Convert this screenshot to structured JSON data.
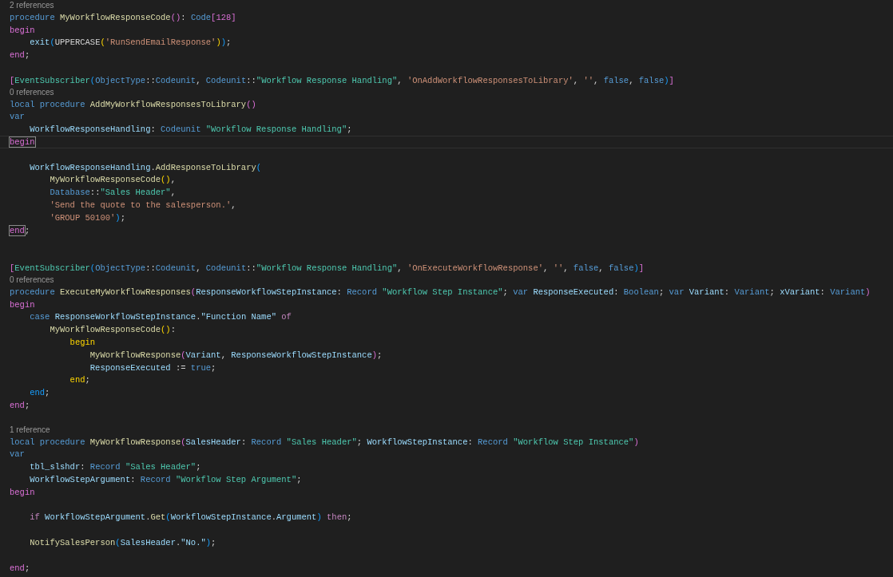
{
  "editor": {
    "lines": [
      {
        "kind": "lens",
        "text": "2 references"
      },
      {
        "kind": "code",
        "tokens": [
          {
            "kind": "kw",
            "text": "procedure"
          },
          {
            "kind": "fn",
            "text": " MyWorkflowResponseCode"
          },
          {
            "kind": "b2",
            "text": "()"
          },
          {
            "kind": "p",
            "text": ": "
          },
          {
            "kind": "kw",
            "text": "Code"
          },
          {
            "kind": "b2",
            "text": "[128]"
          }
        ]
      },
      {
        "kind": "code",
        "tokens": [
          {
            "kind": "b2",
            "text": "begin"
          }
        ]
      },
      {
        "kind": "code",
        "tokens": [
          {
            "kind": "var",
            "text": "    exit"
          },
          {
            "kind": "b3",
            "text": "("
          },
          {
            "kind": "p",
            "text": "UPPERCASE"
          },
          {
            "kind": "b1",
            "text": "("
          },
          {
            "kind": "str",
            "text": "'RunSendEmailResponse'"
          },
          {
            "kind": "b1",
            "text": ")"
          },
          {
            "kind": "b3",
            "text": ")"
          },
          {
            "kind": "p",
            "text": ";"
          }
        ]
      },
      {
        "kind": "code",
        "tokens": [
          {
            "kind": "b2",
            "text": "end"
          },
          {
            "kind": "p",
            "text": ";"
          }
        ]
      },
      {
        "kind": "blank"
      },
      {
        "kind": "code",
        "tokens": [
          {
            "kind": "b2",
            "text": "["
          },
          {
            "kind": "qid",
            "text": "EventSubscriber"
          },
          {
            "kind": "b3",
            "text": "("
          },
          {
            "kind": "kw",
            "text": "ObjectType"
          },
          {
            "kind": "p",
            "text": "::"
          },
          {
            "kind": "kw",
            "text": "Codeunit"
          },
          {
            "kind": "p",
            "text": ", "
          },
          {
            "kind": "kw",
            "text": "Codeunit"
          },
          {
            "kind": "p",
            "text": "::"
          },
          {
            "kind": "qid",
            "text": "\"Workflow Response Handling\""
          },
          {
            "kind": "p",
            "text": ", "
          },
          {
            "kind": "str",
            "text": "'OnAddWorkflowResponsesToLibrary'"
          },
          {
            "kind": "p",
            "text": ", "
          },
          {
            "kind": "str",
            "text": "''"
          },
          {
            "kind": "p",
            "text": ", "
          },
          {
            "kind": "kw",
            "text": "false"
          },
          {
            "kind": "p",
            "text": ", "
          },
          {
            "kind": "kw",
            "text": "false"
          },
          {
            "kind": "b3",
            "text": ")"
          },
          {
            "kind": "b2",
            "text": "]"
          }
        ]
      },
      {
        "kind": "lens",
        "text": "0 references"
      },
      {
        "kind": "code",
        "tokens": [
          {
            "kind": "kw",
            "text": "local procedure"
          },
          {
            "kind": "fn",
            "text": " AddMyWorkflowResponsesToLibrary"
          },
          {
            "kind": "b2",
            "text": "()"
          }
        ]
      },
      {
        "kind": "code",
        "tokens": [
          {
            "kind": "kw",
            "text": "var"
          }
        ]
      },
      {
        "kind": "code",
        "tokens": [
          {
            "kind": "var",
            "text": "    WorkflowResponseHandling"
          },
          {
            "kind": "p",
            "text": ": "
          },
          {
            "kind": "kw",
            "text": "Codeunit"
          },
          {
            "kind": "qid",
            "text": " \"Workflow Response Handling\""
          },
          {
            "kind": "p",
            "text": ";"
          }
        ]
      },
      {
        "kind": "current",
        "tokens": [
          {
            "kind": "match",
            "text": "begin"
          }
        ]
      },
      {
        "kind": "blank"
      },
      {
        "kind": "code",
        "tokens": [
          {
            "kind": "var",
            "text": "    WorkflowResponseHandling"
          },
          {
            "kind": "p",
            "text": "."
          },
          {
            "kind": "fn",
            "text": "AddResponseToLibrary"
          },
          {
            "kind": "b3",
            "text": "("
          }
        ]
      },
      {
        "kind": "code",
        "tokens": [
          {
            "kind": "fn",
            "text": "        MyWorkflowResponseCode"
          },
          {
            "kind": "b1",
            "text": "()"
          },
          {
            "kind": "p",
            "text": ","
          }
        ]
      },
      {
        "kind": "code",
        "tokens": [
          {
            "kind": "kw",
            "text": "        Database"
          },
          {
            "kind": "p",
            "text": "::"
          },
          {
            "kind": "qid",
            "text": "\"Sales Header\""
          },
          {
            "kind": "p",
            "text": ","
          }
        ]
      },
      {
        "kind": "code",
        "tokens": [
          {
            "kind": "str",
            "text": "        'Send the quote to the salesperson.'"
          },
          {
            "kind": "p",
            "text": ","
          }
        ]
      },
      {
        "kind": "code",
        "tokens": [
          {
            "kind": "str",
            "text": "        'GROUP 50100'"
          },
          {
            "kind": "b3",
            "text": ")"
          },
          {
            "kind": "p",
            "text": ";"
          }
        ]
      },
      {
        "kind": "code",
        "tokens": [
          {
            "kind": "match",
            "text": "end"
          },
          {
            "kind": "p",
            "text": ";"
          }
        ]
      },
      {
        "kind": "blank"
      },
      {
        "kind": "blank"
      },
      {
        "kind": "code",
        "tokens": [
          {
            "kind": "b2",
            "text": "["
          },
          {
            "kind": "qid",
            "text": "EventSubscriber"
          },
          {
            "kind": "b3",
            "text": "("
          },
          {
            "kind": "kw",
            "text": "ObjectType"
          },
          {
            "kind": "p",
            "text": "::"
          },
          {
            "kind": "kw",
            "text": "Codeunit"
          },
          {
            "kind": "p",
            "text": ", "
          },
          {
            "kind": "kw",
            "text": "Codeunit"
          },
          {
            "kind": "p",
            "text": "::"
          },
          {
            "kind": "qid",
            "text": "\"Workflow Response Handling\""
          },
          {
            "kind": "p",
            "text": ", "
          },
          {
            "kind": "str",
            "text": "'OnExecuteWorkflowResponse'"
          },
          {
            "kind": "p",
            "text": ", "
          },
          {
            "kind": "str",
            "text": "''"
          },
          {
            "kind": "p",
            "text": ", "
          },
          {
            "kind": "kw",
            "text": "false"
          },
          {
            "kind": "p",
            "text": ", "
          },
          {
            "kind": "kw",
            "text": "false"
          },
          {
            "kind": "b3",
            "text": ")"
          },
          {
            "kind": "b2",
            "text": "]"
          }
        ]
      },
      {
        "kind": "lens",
        "text": "0 references"
      },
      {
        "kind": "code",
        "tokens": [
          {
            "kind": "kw",
            "text": "procedure"
          },
          {
            "kind": "fn",
            "text": " ExecuteMyWorkflowResponses"
          },
          {
            "kind": "b2",
            "text": "("
          },
          {
            "kind": "var",
            "text": "ResponseWorkflowStepInstance"
          },
          {
            "kind": "p",
            "text": ": "
          },
          {
            "kind": "kw",
            "text": "Record"
          },
          {
            "kind": "qid",
            "text": " \"Workflow Step Instance\""
          },
          {
            "kind": "p",
            "text": "; "
          },
          {
            "kind": "kw",
            "text": "var"
          },
          {
            "kind": "var",
            "text": " ResponseExecuted"
          },
          {
            "kind": "p",
            "text": ": "
          },
          {
            "kind": "kw",
            "text": "Boolean"
          },
          {
            "kind": "p",
            "text": "; "
          },
          {
            "kind": "kw",
            "text": "var"
          },
          {
            "kind": "var",
            "text": " Variant"
          },
          {
            "kind": "p",
            "text": ": "
          },
          {
            "kind": "kw",
            "text": "Variant"
          },
          {
            "kind": "p",
            "text": "; "
          },
          {
            "kind": "var",
            "text": "xVariant"
          },
          {
            "kind": "p",
            "text": ": "
          },
          {
            "kind": "kw",
            "text": "Variant"
          },
          {
            "kind": "b2",
            "text": ")"
          }
        ]
      },
      {
        "kind": "code",
        "tokens": [
          {
            "kind": "b2",
            "text": "begin"
          }
        ]
      },
      {
        "kind": "code",
        "tokens": [
          {
            "kind": "kw",
            "text": "    case"
          },
          {
            "kind": "var",
            "text": " ResponseWorkflowStepInstance"
          },
          {
            "kind": "p",
            "text": "."
          },
          {
            "kind": "var",
            "text": "\"Function Name\""
          },
          {
            "kind": "ctl",
            "text": " of"
          }
        ]
      },
      {
        "kind": "code",
        "tokens": [
          {
            "kind": "fn",
            "text": "        MyWorkflowResponseCode"
          },
          {
            "kind": "b1",
            "text": "()"
          },
          {
            "kind": "p",
            "text": ":"
          }
        ]
      },
      {
        "kind": "code",
        "tokens": [
          {
            "kind": "b1",
            "text": "            begin"
          }
        ]
      },
      {
        "kind": "code",
        "tokens": [
          {
            "kind": "fn",
            "text": "                MyWorkflowResponse"
          },
          {
            "kind": "b2",
            "text": "("
          },
          {
            "kind": "var",
            "text": "Variant"
          },
          {
            "kind": "p",
            "text": ", "
          },
          {
            "kind": "var",
            "text": "ResponseWorkflowStepInstance"
          },
          {
            "kind": "b2",
            "text": ")"
          },
          {
            "kind": "p",
            "text": ";"
          }
        ]
      },
      {
        "kind": "code",
        "tokens": [
          {
            "kind": "var",
            "text": "                ResponseExecuted"
          },
          {
            "kind": "p",
            "text": " := "
          },
          {
            "kind": "kw",
            "text": "true"
          },
          {
            "kind": "p",
            "text": ";"
          }
        ]
      },
      {
        "kind": "code",
        "tokens": [
          {
            "kind": "b1",
            "text": "            end"
          },
          {
            "kind": "p",
            "text": ";"
          }
        ]
      },
      {
        "kind": "code",
        "tokens": [
          {
            "kind": "b3",
            "text": "    end"
          },
          {
            "kind": "p",
            "text": ";"
          }
        ]
      },
      {
        "kind": "code",
        "tokens": [
          {
            "kind": "b2",
            "text": "end"
          },
          {
            "kind": "p",
            "text": ";"
          }
        ]
      },
      {
        "kind": "blank"
      },
      {
        "kind": "lens",
        "text": "1 reference"
      },
      {
        "kind": "code",
        "tokens": [
          {
            "kind": "kw",
            "text": "local procedure"
          },
          {
            "kind": "fn",
            "text": " MyWorkflowResponse"
          },
          {
            "kind": "b2",
            "text": "("
          },
          {
            "kind": "var",
            "text": "SalesHeader"
          },
          {
            "kind": "p",
            "text": ": "
          },
          {
            "kind": "kw",
            "text": "Record"
          },
          {
            "kind": "qid",
            "text": " \"Sales Header\""
          },
          {
            "kind": "p",
            "text": "; "
          },
          {
            "kind": "var",
            "text": "WorkflowStepInstance"
          },
          {
            "kind": "p",
            "text": ": "
          },
          {
            "kind": "kw",
            "text": "Record"
          },
          {
            "kind": "qid",
            "text": " \"Workflow Step Instance\""
          },
          {
            "kind": "b2",
            "text": ")"
          }
        ]
      },
      {
        "kind": "code",
        "tokens": [
          {
            "kind": "kw",
            "text": "var"
          }
        ]
      },
      {
        "kind": "code",
        "tokens": [
          {
            "kind": "var",
            "text": "    tbl_slshdr"
          },
          {
            "kind": "p",
            "text": ": "
          },
          {
            "kind": "kw",
            "text": "Record"
          },
          {
            "kind": "qid",
            "text": " \"Sales Header\""
          },
          {
            "kind": "p",
            "text": ";"
          }
        ]
      },
      {
        "kind": "code",
        "tokens": [
          {
            "kind": "var",
            "text": "    WorkflowStepArgument"
          },
          {
            "kind": "p",
            "text": ": "
          },
          {
            "kind": "kw",
            "text": "Record"
          },
          {
            "kind": "qid",
            "text": " \"Workflow Step Argument\""
          },
          {
            "kind": "p",
            "text": ";"
          }
        ]
      },
      {
        "kind": "code",
        "tokens": [
          {
            "kind": "b2",
            "text": "begin"
          }
        ]
      },
      {
        "kind": "blank"
      },
      {
        "kind": "code",
        "tokens": [
          {
            "kind": "ctl",
            "text": "    if"
          },
          {
            "kind": "var",
            "text": " WorkflowStepArgument"
          },
          {
            "kind": "p",
            "text": "."
          },
          {
            "kind": "fn",
            "text": "Get"
          },
          {
            "kind": "b3",
            "text": "("
          },
          {
            "kind": "var",
            "text": "WorkflowStepInstance"
          },
          {
            "kind": "p",
            "text": "."
          },
          {
            "kind": "var",
            "text": "Argument"
          },
          {
            "kind": "b3",
            "text": ")"
          },
          {
            "kind": "ctl",
            "text": " then"
          },
          {
            "kind": "p",
            "text": ";"
          }
        ]
      },
      {
        "kind": "blank"
      },
      {
        "kind": "code",
        "tokens": [
          {
            "kind": "fn",
            "text": "    NotifySalesPerson"
          },
          {
            "kind": "b3",
            "text": "("
          },
          {
            "kind": "var",
            "text": "SalesHeader"
          },
          {
            "kind": "p",
            "text": "."
          },
          {
            "kind": "var",
            "text": "\"No.\""
          },
          {
            "kind": "b3",
            "text": ")"
          },
          {
            "kind": "p",
            "text": ";"
          }
        ]
      },
      {
        "kind": "blank"
      },
      {
        "kind": "code",
        "tokens": [
          {
            "kind": "b2",
            "text": "end"
          },
          {
            "kind": "p",
            "text": ";"
          }
        ]
      }
    ]
  }
}
